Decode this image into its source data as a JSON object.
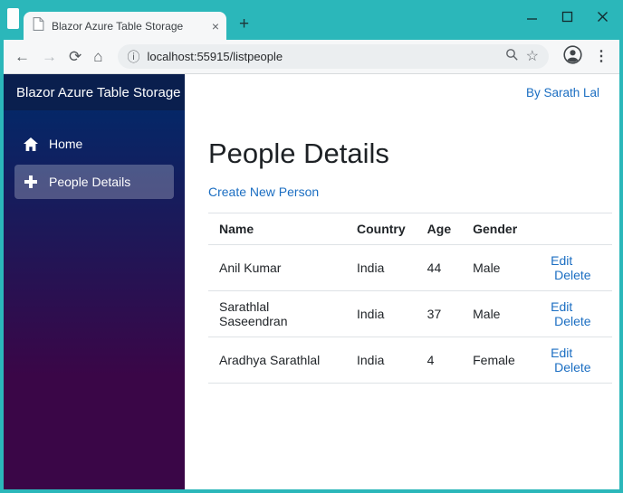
{
  "window": {
    "tab_title": "Blazor Azure Table Storage",
    "url": "localhost:55915/listpeople"
  },
  "icons": {
    "back": "←",
    "forward": "→",
    "refresh": "⟳",
    "home": "⌂",
    "info": "ⓘ",
    "star": "☆",
    "menu_dots": "⋮",
    "tab_close": "×",
    "new_tab": "+"
  },
  "app": {
    "brand": "Blazor Azure Table Storage",
    "byline": "By Sarath Lal",
    "sidebar": {
      "items": [
        {
          "label": "Home"
        },
        {
          "label": "People Details"
        }
      ]
    },
    "page": {
      "title": "People Details",
      "create_link": "Create New Person",
      "table": {
        "headers": [
          "Name",
          "Country",
          "Age",
          "Gender"
        ],
        "actions": {
          "edit": "Edit",
          "delete": "Delete"
        },
        "rows": [
          {
            "name": "Anil Kumar",
            "country": "India",
            "age": "44",
            "gender": "Male"
          },
          {
            "name": "Sarathlal Saseendran",
            "country": "India",
            "age": "37",
            "gender": "Male"
          },
          {
            "name": "Aradhya Sarathlal",
            "country": "India",
            "age": "4",
            "gender": "Female"
          }
        ]
      }
    }
  },
  "colors": {
    "frame": "#2bb7ba",
    "accent_link": "#1b6ec2",
    "brand_bar": "#0a1f4e",
    "sidebar_gradient_top": "#052767",
    "sidebar_gradient_bottom": "#3a0647",
    "active_nav_bg": "rgba(255,255,255,0.25)"
  }
}
